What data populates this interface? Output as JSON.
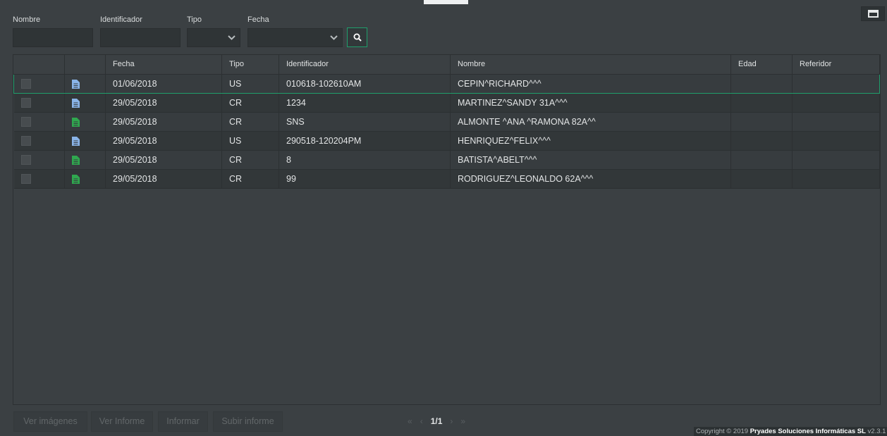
{
  "filters": {
    "nombre_label": "Nombre",
    "identificador_label": "Identificador",
    "tipo_label": "Tipo",
    "fecha_label": "Fecha",
    "nombre_value": "",
    "identificador_value": "",
    "tipo_value": "",
    "fecha_value": ""
  },
  "table": {
    "headers": [
      "",
      "",
      "Fecha",
      "Tipo",
      "Identificador",
      "Nombre",
      "Edad",
      "Referidor"
    ],
    "rows": [
      {
        "fecha": "01/06/2018",
        "tipo": "US",
        "identificador": "010618-102610AM",
        "nombre": "CEPIN^RICHARD^^^",
        "edad": "",
        "referidor": "",
        "doc_color": "#8ab4e8"
      },
      {
        "fecha": "29/05/2018",
        "tipo": "CR",
        "identificador": "1234",
        "nombre": "MARTINEZ^SANDY 31A^^^",
        "edad": "",
        "referidor": "",
        "doc_color": "#8ab4e8"
      },
      {
        "fecha": "29/05/2018",
        "tipo": "CR",
        "identificador": "SNS",
        "nombre": "ALMONTE ^ANA ^RAMONA 82A^^",
        "edad": "",
        "referidor": "",
        "doc_color": "#2fa84f"
      },
      {
        "fecha": "29/05/2018",
        "tipo": "US",
        "identificador": "290518-120204PM",
        "nombre": "HENRIQUEZ^FELIX^^^",
        "edad": "",
        "referidor": "",
        "doc_color": "#8ab4e8"
      },
      {
        "fecha": "29/05/2018",
        "tipo": "CR",
        "identificador": "8",
        "nombre": "BATISTA^ABELT^^^",
        "edad": "",
        "referidor": "",
        "doc_color": "#2fa84f"
      },
      {
        "fecha": "29/05/2018",
        "tipo": "CR",
        "identificador": "99",
        "nombre": "RODRIGUEZ^LEONALDO 62A^^^",
        "edad": "",
        "referidor": "",
        "doc_color": "#2fa84f"
      }
    ]
  },
  "footer": {
    "ver_imagenes": "Ver imágenes",
    "ver_informe": "Ver Informe",
    "informar": "Informar",
    "subir_informe": "Subir informe",
    "first": "«",
    "prev": "‹",
    "page": "1/1",
    "next": "›",
    "last": "»",
    "copyright_prefix": "Copyright © 2019 ",
    "copyright_company": "Pryades Soluciones Informáticas SL",
    "copyright_version": " v2.3.1"
  },
  "colors": {
    "accent": "#1f9e6b",
    "background": "#3b4043",
    "doc_blue": "#8ab4e8",
    "doc_green": "#2fa84f"
  },
  "icons": {
    "search": "search-icon",
    "chevron": "chevron-down-icon",
    "document": "document-icon",
    "window": "maximize-icon"
  }
}
